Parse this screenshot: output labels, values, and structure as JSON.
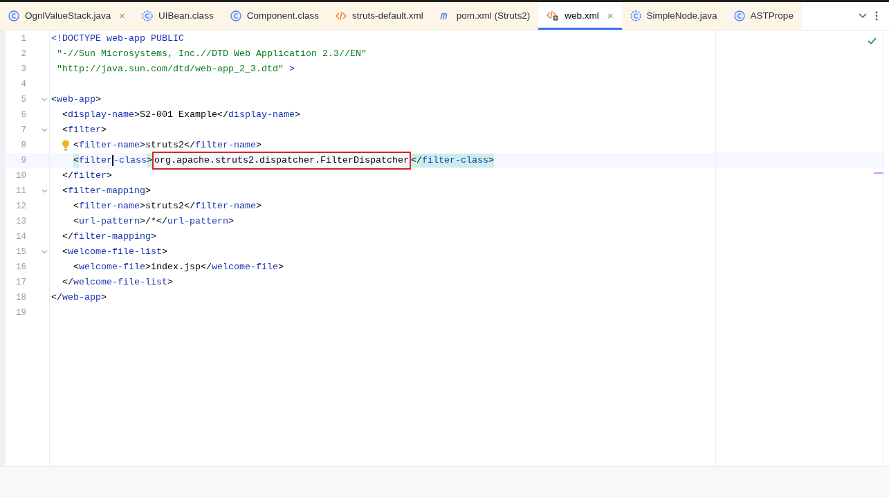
{
  "tabs": [
    {
      "label": "OgnlValueStack.java",
      "kind": "class",
      "selected": false,
      "close": "×"
    },
    {
      "label": "UIBean.class",
      "kind": "classdash",
      "selected": false
    },
    {
      "label": "Component.class",
      "kind": "class",
      "selected": false
    },
    {
      "label": "struts-default.xml",
      "kind": "xml",
      "selected": false
    },
    {
      "label": "pom.xml (Struts2)",
      "kind": "maven",
      "selected": false
    },
    {
      "label": "web.xml",
      "kind": "webxml",
      "selected": true,
      "close": "×"
    },
    {
      "label": "SimpleNode.java",
      "kind": "classdash",
      "selected": false
    },
    {
      "label": "ASTPrope",
      "kind": "class",
      "selected": false
    }
  ],
  "editor": {
    "lines": [
      {
        "number": "1",
        "tokens": [
          {
            "kind": "tag",
            "s": "<!DOCTYPE web-app PUBLIC"
          }
        ]
      },
      {
        "number": "2",
        "tokens": [
          {
            "kind": "string",
            "s": " \"-//Sun Microsystems, Inc.//DTD Web Application 2.3//EN\""
          }
        ]
      },
      {
        "number": "3",
        "tokens": [
          {
            "kind": "string",
            "s": " \"http://java.sun.com/dtd/web-app_2_3.dtd\""
          },
          {
            "kind": "tag",
            "s": " >"
          }
        ]
      },
      {
        "number": "4"
      },
      {
        "number": "5",
        "foldable": true,
        "tokens": [
          {
            "kind": "plain",
            "s": "<"
          },
          {
            "kind": "tag",
            "s": "web-app"
          },
          {
            "kind": "plain",
            "s": ">"
          }
        ]
      },
      {
        "number": "6",
        "tokens": [
          {
            "kind": "plain",
            "s": "  <"
          },
          {
            "kind": "tag",
            "s": "display-name"
          },
          {
            "kind": "plain",
            "s": ">S2-001 Example</"
          },
          {
            "kind": "tag",
            "s": "display-name"
          },
          {
            "kind": "plain",
            "s": ">"
          }
        ]
      },
      {
        "number": "7",
        "foldable": true,
        "tokens": [
          {
            "kind": "plain",
            "s": "  <"
          },
          {
            "kind": "tag",
            "s": "filter"
          },
          {
            "kind": "plain",
            "s": ">"
          }
        ]
      },
      {
        "number": "8",
        "bulb": true,
        "tokens": [
          {
            "kind": "plain",
            "s": "    <"
          },
          {
            "kind": "tag",
            "s": "filter-name"
          },
          {
            "kind": "plain",
            "s": ">struts2</"
          },
          {
            "kind": "tag",
            "s": "filter-name"
          },
          {
            "kind": "plain",
            "s": ">"
          }
        ]
      },
      {
        "number": "9",
        "current": true,
        "tokens": [
          {
            "kind": "plain",
            "s": "    <",
            "matched": true
          },
          {
            "kind": "tag",
            "s": "filter",
            "caret": true
          },
          {
            "kind": "tag",
            "s": "-class"
          },
          {
            "kind": "plain",
            "s": ">",
            "matched": true
          },
          {
            "kind": "plain",
            "s": "org.apache.struts2.dispatcher.FilterDispatcher",
            "boxed": true
          },
          {
            "kind": "plain",
            "s": "</",
            "matched": true
          },
          {
            "kind": "tag",
            "s": "filter-class",
            "matched": true
          },
          {
            "kind": "plain",
            "s": ">",
            "matched": true
          }
        ]
      },
      {
        "number": "10",
        "tokens": [
          {
            "kind": "plain",
            "s": "  </"
          },
          {
            "kind": "tag",
            "s": "filter"
          },
          {
            "kind": "plain",
            "s": ">"
          }
        ]
      },
      {
        "number": "11",
        "foldable": true,
        "tokens": [
          {
            "kind": "plain",
            "s": "  <"
          },
          {
            "kind": "tag",
            "s": "filter-mapping"
          },
          {
            "kind": "plain",
            "s": ">"
          }
        ]
      },
      {
        "number": "12",
        "tokens": [
          {
            "kind": "plain",
            "s": "    <"
          },
          {
            "kind": "tag",
            "s": "filter-name"
          },
          {
            "kind": "plain",
            "s": ">struts2</"
          },
          {
            "kind": "tag",
            "s": "filter-name"
          },
          {
            "kind": "plain",
            "s": ">"
          }
        ]
      },
      {
        "number": "13",
        "tokens": [
          {
            "kind": "plain",
            "s": "    <"
          },
          {
            "kind": "tag",
            "s": "url-pattern"
          },
          {
            "kind": "plain",
            "s": ">/*</"
          },
          {
            "kind": "tag",
            "s": "url-pattern"
          },
          {
            "kind": "plain",
            "s": ">"
          }
        ]
      },
      {
        "number": "14",
        "tokens": [
          {
            "kind": "plain",
            "s": "  </"
          },
          {
            "kind": "tag",
            "s": "filter-mapping"
          },
          {
            "kind": "plain",
            "s": ">"
          }
        ]
      },
      {
        "number": "15",
        "foldable": true,
        "tokens": [
          {
            "kind": "plain",
            "s": "  <"
          },
          {
            "kind": "tag",
            "s": "welcome-file-list"
          },
          {
            "kind": "plain",
            "s": ">"
          }
        ]
      },
      {
        "number": "16",
        "tokens": [
          {
            "kind": "plain",
            "s": "    <"
          },
          {
            "kind": "tag",
            "s": "welcome-file"
          },
          {
            "kind": "plain",
            "s": ">index.jsp</"
          },
          {
            "kind": "tag",
            "s": "welcome-file"
          },
          {
            "kind": "plain",
            "s": ">"
          }
        ]
      },
      {
        "number": "17",
        "tokens": [
          {
            "kind": "plain",
            "s": "  </"
          },
          {
            "kind": "tag",
            "s": "welcome-file-list"
          },
          {
            "kind": "plain",
            "s": ">"
          }
        ]
      },
      {
        "number": "18",
        "tokens": [
          {
            "kind": "plain",
            "s": "</"
          },
          {
            "kind": "tag",
            "s": "web-app"
          },
          {
            "kind": "plain",
            "s": ">"
          }
        ]
      },
      {
        "number": "19"
      }
    ]
  }
}
